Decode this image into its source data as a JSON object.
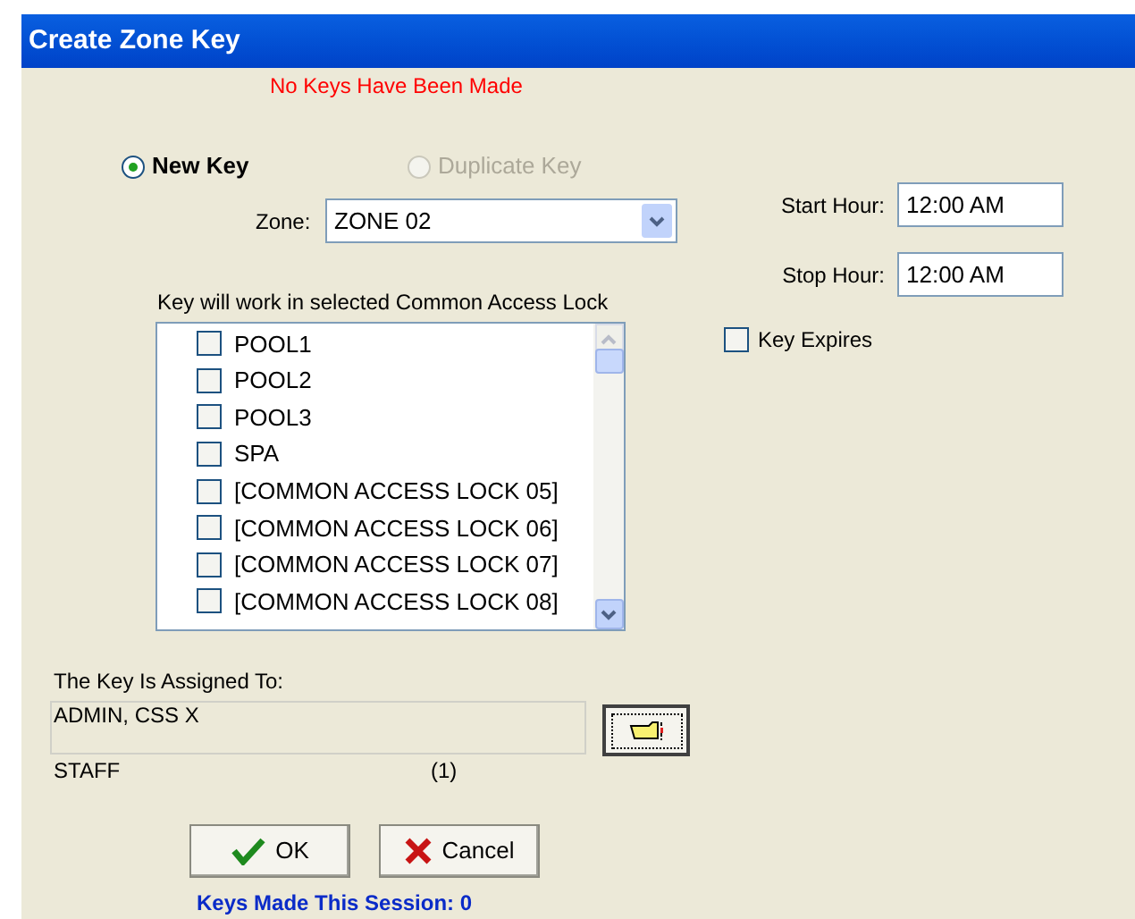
{
  "window": {
    "title": "Create Zone Key"
  },
  "status_message": "No Keys Have Been Made",
  "key_types": [
    {
      "label": "New Key",
      "selected": true,
      "disabled": false
    },
    {
      "label": "Duplicate Key",
      "selected": false,
      "disabled": true
    }
  ],
  "zone": {
    "label": "Zone:",
    "value": "ZONE 02"
  },
  "lock_list": {
    "label": "Key will work in selected Common Access Lock",
    "items": [
      {
        "label": "POOL1",
        "checked": false
      },
      {
        "label": "POOL2",
        "checked": false
      },
      {
        "label": "POOL3",
        "checked": false
      },
      {
        "label": "SPA",
        "checked": false
      },
      {
        "label": "[COMMON ACCESS LOCK 05]",
        "checked": false
      },
      {
        "label": "[COMMON ACCESS LOCK 06]",
        "checked": false
      },
      {
        "label": "[COMMON ACCESS LOCK 07]",
        "checked": false
      },
      {
        "label": "[COMMON ACCESS LOCK 08]",
        "checked": false
      }
    ]
  },
  "hours": [
    {
      "label": "Start Hour:",
      "value": "12:00 AM"
    },
    {
      "label": "Stop Hour:",
      "value": "12:00 AM"
    }
  ],
  "key_expires": {
    "label": "Key Expires",
    "checked": false
  },
  "assigned": {
    "label": "The Key Is Assigned To:",
    "value": "ADMIN, CSS X",
    "group": "STAFF",
    "count": "(1)"
  },
  "buttons": [
    {
      "kind": "ok",
      "label": "OK"
    },
    {
      "kind": "cancel",
      "label": "Cancel"
    }
  ],
  "session_count": "Keys Made This Session: 0"
}
